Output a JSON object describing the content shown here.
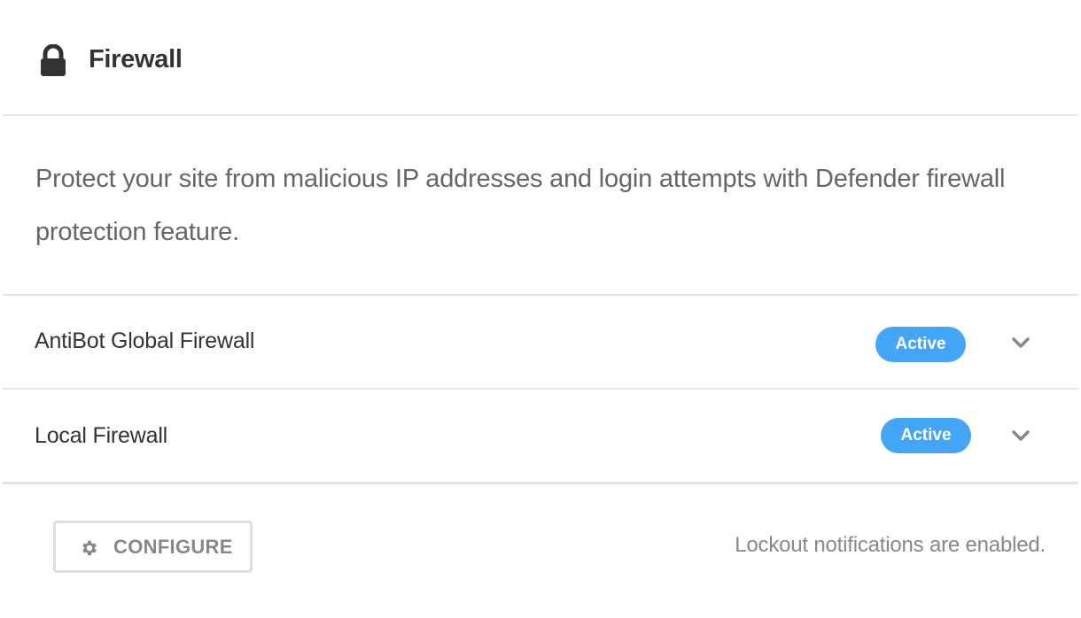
{
  "header": {
    "icon": "lock-icon",
    "title": "Firewall"
  },
  "description": "Protect your site from malicious IP addresses and login attempts with Defender firewall protection feature.",
  "modules": [
    {
      "label": "AntiBot Global Firewall",
      "status": "Active",
      "expand_icon": "chevron-down-icon"
    },
    {
      "label": "Local Firewall",
      "status": "Active",
      "expand_icon": "chevron-down-icon"
    }
  ],
  "footer": {
    "configure_icon": "gear-icon",
    "configure_label": "CONFIGURE",
    "notice": "Lockout notifications are enabled."
  },
  "colors": {
    "badge": "#42a5f5",
    "title": "#333333",
    "muted": "#888888",
    "divider": "#e6e6e6"
  }
}
